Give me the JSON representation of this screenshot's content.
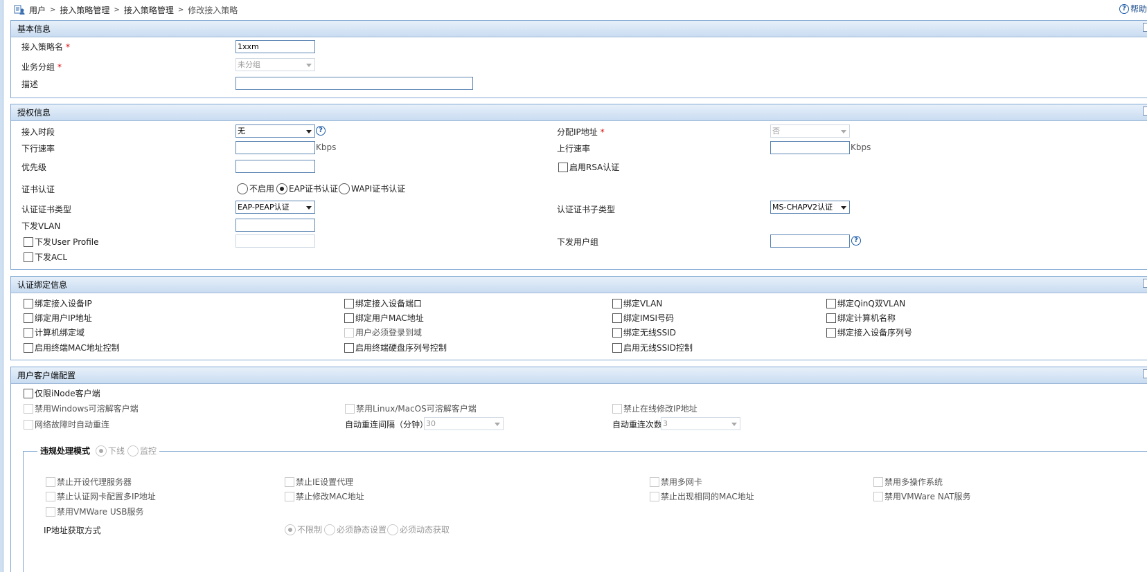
{
  "breadcrumb": {
    "items": [
      "用户",
      "接入策略管理",
      "接入策略管理"
    ],
    "current": "修改接入策略",
    "sep": ">"
  },
  "help": {
    "label": "帮助"
  },
  "basic": {
    "title": "基本信息",
    "name_label": "接入策略名",
    "name_value": "1xxm",
    "group_label": "业务分组",
    "group_value": "未分组",
    "desc_label": "描述",
    "desc_value": ""
  },
  "auth": {
    "title": "授权信息",
    "time_label": "接入时段",
    "time_value": "无",
    "assign_ip_label": "分配IP地址",
    "assign_ip_value": "否",
    "down_rate_label": "下行速率",
    "down_unit": "Kbps",
    "up_rate_label": "上行速率",
    "up_unit": "Kbps",
    "priority_label": "优先级",
    "rsa_label": "启用RSA认证",
    "cert_label": "证书认证",
    "cert_options": [
      "不启用",
      "EAP证书认证",
      "WAPI证书认证"
    ],
    "cert_type_label": "认证证书类型",
    "cert_type_value": "EAP-PEAP认证",
    "cert_subtype_label": "认证证书子类型",
    "cert_subtype_value": "MS-CHAPV2认证",
    "vlan_label": "下发VLAN",
    "user_profile_label": "下发User Profile",
    "user_group_label": "下发用户组",
    "acl_label": "下发ACL"
  },
  "bind": {
    "title": "认证绑定信息",
    "items": [
      "绑定接入设备IP",
      "绑定接入设备端口",
      "绑定VLAN",
      "绑定QinQ双VLAN",
      "绑定用户IP地址",
      "绑定用户MAC地址",
      "绑定IMSI号码",
      "绑定计算机名称",
      "计算机绑定域",
      "用户必须登录到域",
      "绑定无线SSID",
      "绑定接入设备序列号",
      "启用终端MAC地址控制",
      "启用终端硬盘序列号控制",
      "启用无线SSID控制"
    ]
  },
  "client": {
    "title": "用户客户端配置",
    "inode_only": "仅限iNode客户端",
    "forbid_win": "禁用Windows可溶解客户端",
    "forbid_linux": "禁用Linux/MacOS可溶解客户端",
    "forbid_modify_ip": "禁止在线修改IP地址",
    "auto_reconnect": "网络故障时自动重连",
    "reconnect_interval_label": "自动重连间隔（分钟）",
    "reconnect_interval_value": "30",
    "reconnect_times_label": "自动重连次数",
    "reconnect_times_value": "3",
    "violation_title": "违规处理模式",
    "violation_options": [
      "下线",
      "监控"
    ],
    "checks": [
      "禁止开设代理服务器",
      "禁止IE设置代理",
      "禁用多网卡",
      "禁用多操作系统",
      "禁止认证网卡配置多IP地址",
      "禁止修改MAC地址",
      "禁止出现相同的MAC地址",
      "禁用VMWare NAT服务",
      "禁用VMWare USB服务"
    ],
    "ip_mode_label": "IP地址获取方式",
    "ip_mode_options": [
      "不限制",
      "必须静态设置",
      "必须动态获取"
    ]
  }
}
